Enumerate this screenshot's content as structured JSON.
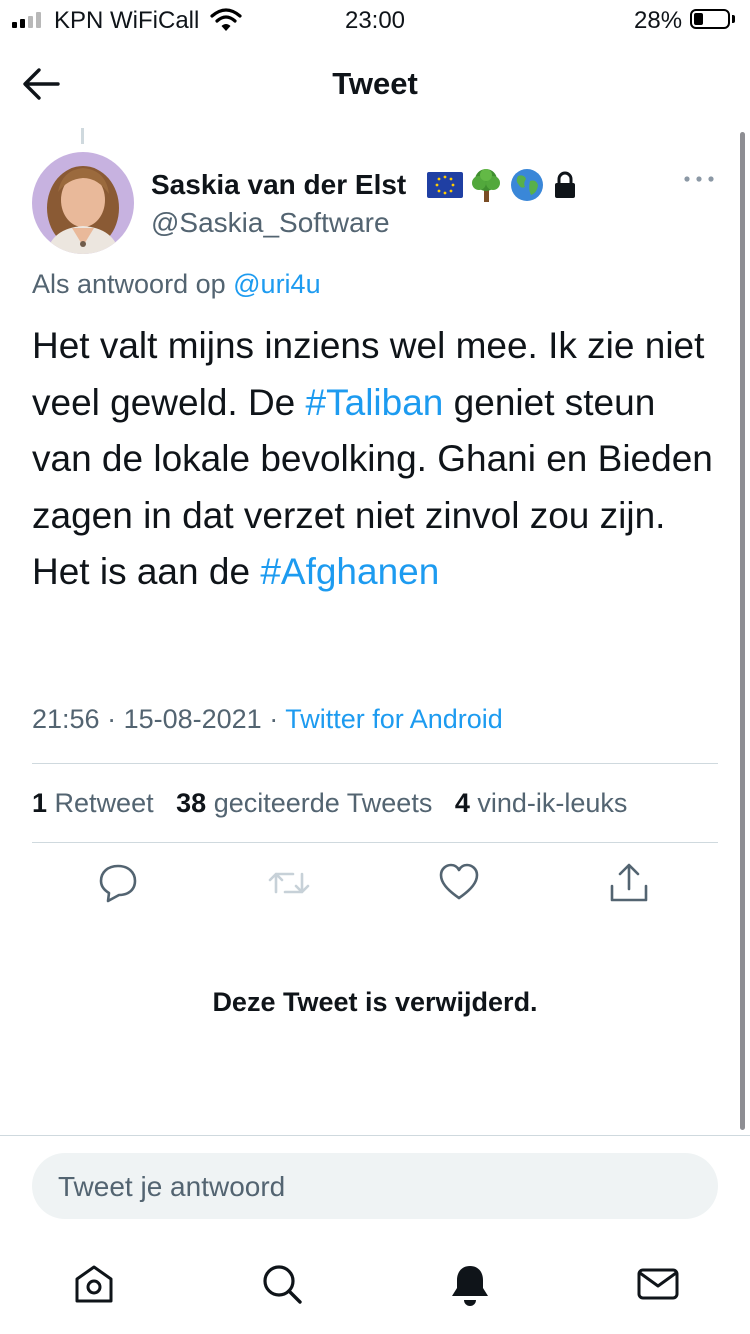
{
  "status_bar": {
    "carrier": "KPN WiFiCall",
    "time": "23:00",
    "battery": "28%",
    "battery_level": 0.28
  },
  "header": {
    "title": "Tweet",
    "back_icon": "back-arrow-icon"
  },
  "tweet": {
    "author_name": "Saskia van der Elst",
    "author_handle": "@Saskia_Software",
    "badges": [
      "eu-flag-icon",
      "tree-icon",
      "globe-icon",
      "lock-icon"
    ],
    "reply_prefix": "Als antwoord op",
    "reply_to": "@uri4u",
    "body": {
      "part1": "Het valt mijns inziens wel mee. Ik zie niet veel geweld. De ",
      "tag1": "#Taliban",
      "part2": " geniet steun van de lokale bevolking. Ghani en Bieden zagen in dat verzet niet zinvol zou zijn. Het is aan de ",
      "tag2": "#Afghanen"
    },
    "time": "21:56",
    "date": "15-08-2021",
    "source": "Twitter for Android",
    "stats": {
      "retweets_count": "1",
      "retweets_label": "Retweet",
      "quotes_count": "38",
      "quotes_label": "geciteerde Tweets",
      "likes_count": "4",
      "likes_label": "vind-ik-leuks"
    }
  },
  "deleted_notice": "Deze Tweet is verwijderd.",
  "reply_input": {
    "placeholder": "Tweet je antwoord",
    "value": ""
  },
  "tab_bar": [
    "home-icon",
    "search-icon",
    "notifications-icon",
    "messages-icon"
  ],
  "colors": {
    "accent": "#1d9bf0",
    "text": "#0f1419",
    "secondary": "#536471",
    "divider": "#cfd9de"
  }
}
